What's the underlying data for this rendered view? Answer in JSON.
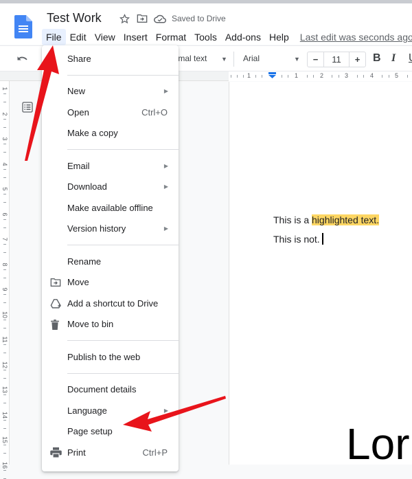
{
  "app": {
    "doc_title": "Test Work",
    "saved_status": "Saved to Drive",
    "last_edit": "Last edit was seconds ago"
  },
  "menubar": [
    "File",
    "Edit",
    "View",
    "Insert",
    "Format",
    "Tools",
    "Add-ons",
    "Help"
  ],
  "toolbar": {
    "paragraph_style": "Normal text",
    "font": "Arial",
    "font_size": "11",
    "minus": "−",
    "plus": "+",
    "bold": "B",
    "italic": "I",
    "underline": "U"
  },
  "ruler": {
    "horizontal_labels": [
      "1",
      "1",
      "2",
      "3",
      "4",
      "5"
    ],
    "vertical_labels": [
      "1",
      "2",
      "3",
      "4",
      "5",
      "6",
      "7",
      "8",
      "9",
      "10",
      "11",
      "12",
      "13",
      "14",
      "15",
      "16"
    ]
  },
  "file_menu": {
    "groups": [
      [
        {
          "label": "Share"
        }
      ],
      [
        {
          "label": "New",
          "submenu": true
        },
        {
          "label": "Open",
          "shortcut": "Ctrl+O"
        },
        {
          "label": "Make a copy"
        }
      ],
      [
        {
          "label": "Email",
          "submenu": true
        },
        {
          "label": "Download",
          "submenu": true
        },
        {
          "label": "Make available offline"
        },
        {
          "label": "Version history",
          "submenu": true
        }
      ],
      [
        {
          "label": "Rename"
        },
        {
          "label": "Move",
          "icon": "move-folder-icon"
        },
        {
          "label": "Add a shortcut to Drive",
          "icon": "drive-shortcut-icon"
        },
        {
          "label": "Move to bin",
          "icon": "trash-icon"
        }
      ],
      [
        {
          "label": "Publish to the web"
        }
      ],
      [
        {
          "label": "Document details"
        },
        {
          "label": "Language",
          "submenu": true
        },
        {
          "label": "Page setup"
        },
        {
          "label": "Print",
          "icon": "print-icon",
          "shortcut": "Ctrl+P"
        }
      ]
    ]
  },
  "document": {
    "line1_prefix": "This is a ",
    "line1_highlight": "highlighted text.",
    "line2": "This is not.",
    "large_text": "Lor"
  },
  "colors": {
    "highlight": "#fdd663",
    "accent_blue": "#4285f4",
    "annotation_red": "#e8141b"
  }
}
